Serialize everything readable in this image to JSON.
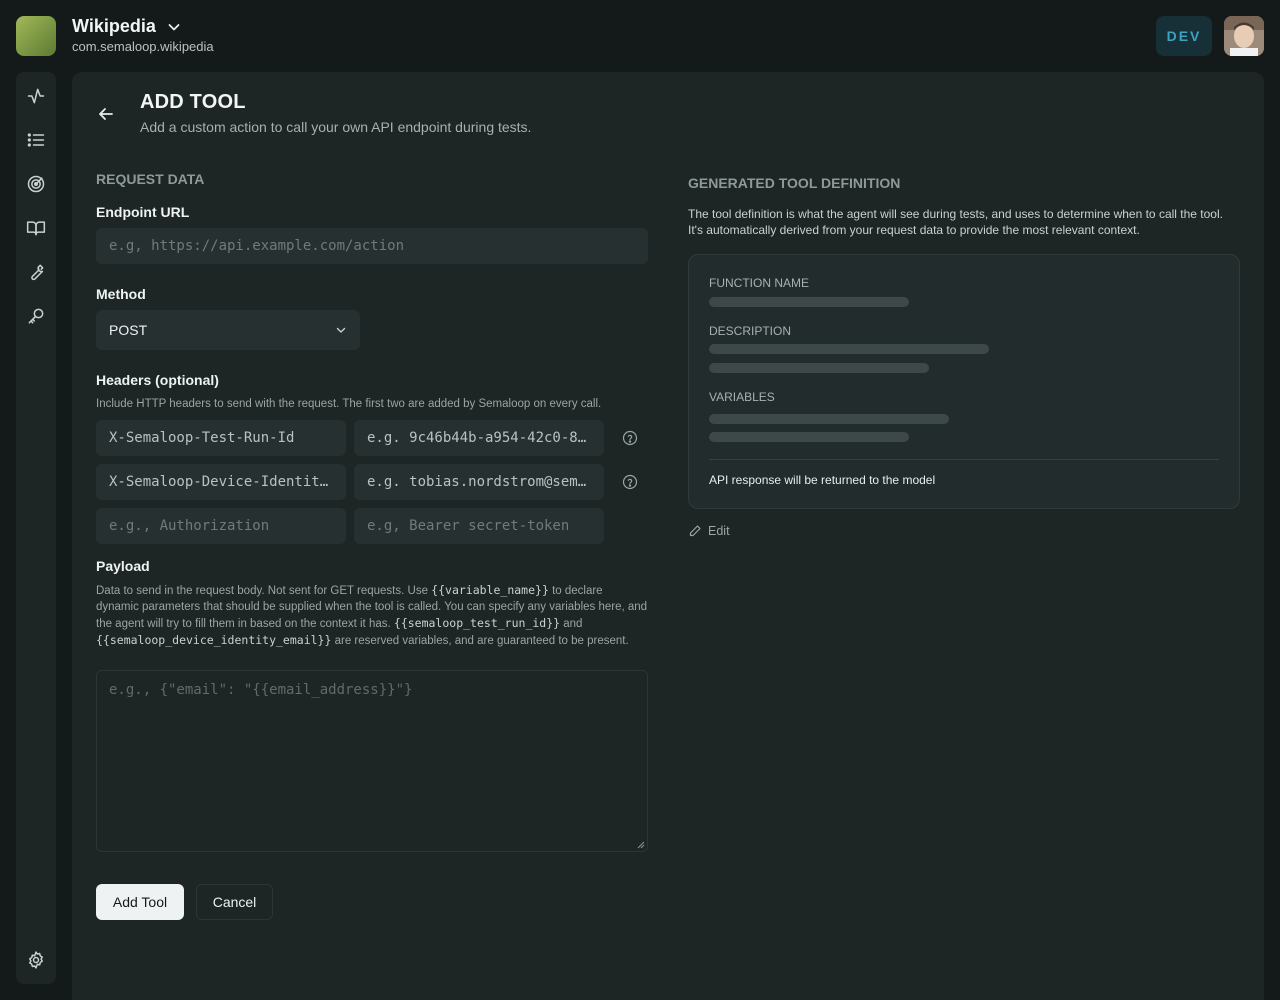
{
  "app": {
    "name": "Wikipedia",
    "bundle_id": "com.semaloop.wikipedia",
    "env_badge": "DEV"
  },
  "sidebar": {
    "items": [
      {
        "icon": "activity-icon"
      },
      {
        "icon": "list-icon"
      },
      {
        "icon": "target-icon"
      },
      {
        "icon": "book-icon"
      },
      {
        "icon": "wrench-icon"
      },
      {
        "icon": "key-icon"
      }
    ],
    "bottom_icon": "gear-icon"
  },
  "page": {
    "title": "ADD TOOL",
    "subtitle": "Add a custom action to call your own API endpoint during tests."
  },
  "request": {
    "section": "REQUEST DATA",
    "endpoint": {
      "label": "Endpoint URL",
      "placeholder": "e.g, https://api.example.com/action"
    },
    "method": {
      "label": "Method",
      "value": "POST"
    },
    "headers": {
      "label": "Headers (optional)",
      "help": "Include HTTP headers to send with the request. The first two are added by Semaloop on every call.",
      "rows": [
        {
          "key": "X-Semaloop-Test-Run-Id",
          "value_placeholder": "e.g. 9c46b44b-a954-42c0-8…"
        },
        {
          "key": "X-Semaloop-Device-Identit…",
          "value_placeholder": "e.g. tobias.nordstrom@sem…"
        },
        {
          "key_placeholder": "e.g., Authorization",
          "value_placeholder": "e.g, Bearer secret-token"
        }
      ]
    },
    "payload": {
      "label": "Payload",
      "help_1": "Data to send in the request body. Not sent for GET requests. Use ",
      "var_name": "{{variable_name}}",
      "help_2": " to declare dynamic parameters that should be supplied when the tool is called. You can specify any variables here, and the agent will try to fill them in based on the context it has. ",
      "var_run_id": "{{semaloop_test_run_id}}",
      "help_3": " and ",
      "var_email": "{{semaloop_device_identity_email}}",
      "help_4": " are reserved variables, and are guaranteed to be present.",
      "placeholder": "e.g., {\"email\": \"{{email_address}}\"}"
    },
    "buttons": {
      "submit": "Add Tool",
      "cancel": "Cancel"
    }
  },
  "definition": {
    "section": "GENERATED TOOL DEFINITION",
    "description_1": "The tool definition is what the agent will see during tests, and uses to determine when to call the tool.",
    "description_2": "It's automatically derived from your request data to provide the most relevant context.",
    "function_name_label": "FUNCTION NAME",
    "description_label": "DESCRIPTION",
    "variables_label": "VARIABLES",
    "note": "API response will be returned to the model",
    "edit_label": "Edit"
  }
}
